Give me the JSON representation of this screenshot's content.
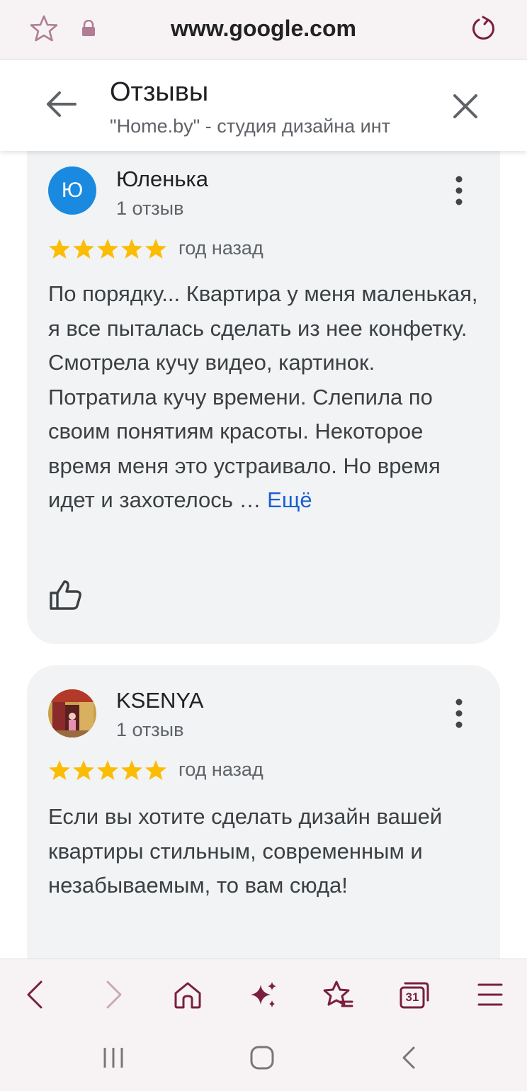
{
  "browser": {
    "url": "www.google.com"
  },
  "header": {
    "title": "Отзывы",
    "subtitle": "\"Home.by\" - студия дизайна инт"
  },
  "reviews": [
    {
      "author": "Юленька",
      "avatar_letter": "Ю",
      "review_count": "1 отзыв",
      "rating": 5,
      "date": "год назад",
      "text": "По порядку... Квартира у меня маленькая, я все пыталась сделать из нее конфетку. Смотрела кучу видео, картинок. Потратила кучу времени. Слепила по своим понятиям красоты. Некоторое время меня это устраивало. Но время идет и захотелось …",
      "more_label": "Ещё"
    },
    {
      "author": "KSENYA",
      "review_count": "1 отзыв",
      "rating": 5,
      "date": "год назад",
      "text": "Если вы хотите сделать дизайн вашей квартиры стильным, современным и незабываемым, то вам сюда!"
    }
  ],
  "colors": {
    "accent": "#7a1f3d",
    "star": "#fbbc04",
    "link": "#1a5fd0",
    "avatar": "#1a8ae0",
    "card": "#f1f3f4"
  },
  "toolbar": {
    "icons": [
      "back-icon",
      "forward-icon",
      "home-icon",
      "ai-sparkle-icon",
      "bookmarks-icon",
      "tabs-icon",
      "menu-icon"
    ],
    "tabs_count": "31"
  }
}
